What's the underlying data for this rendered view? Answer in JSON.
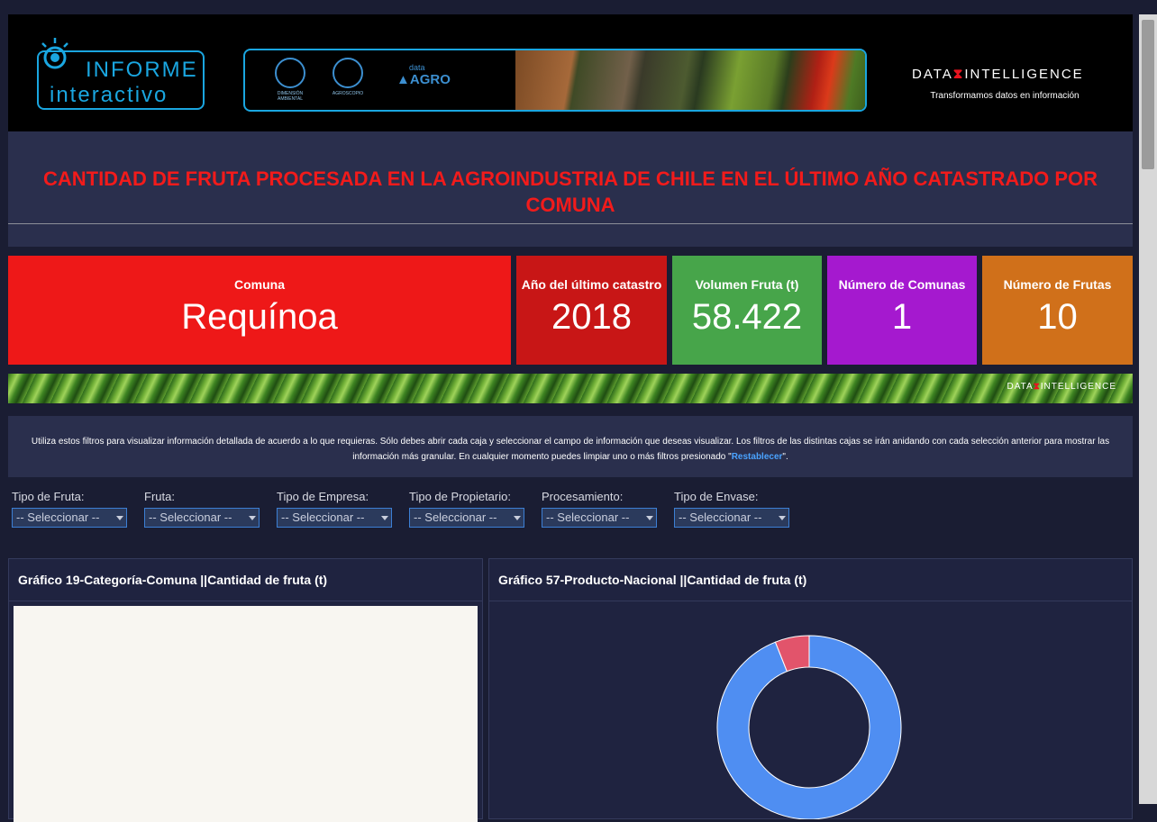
{
  "header": {
    "logo_line1": "INFORME",
    "logo_line2": "interactivo",
    "banner_logo1": "DIMENSIÓN AMBIENTAL",
    "banner_logo2": "AGROSCOPIO",
    "banner_logo3_small": "data",
    "banner_logo3": "AGRO",
    "brand_left": "DATA",
    "brand_right": "INTELLIGENCE",
    "brand_tagline": "Transformamos datos en información"
  },
  "title": "CANTIDAD DE FRUTA PROCESADA EN LA AGROINDUSTRIA DE CHILE EN EL ÚLTIMO AÑO CATASTRADO POR COMUNA",
  "kpis": [
    {
      "label": "Comuna",
      "value": "Requínoa",
      "color": "#ee1818"
    },
    {
      "label": "Año del último catastro",
      "value": "2018",
      "color": "#c81616"
    },
    {
      "label": "Volumen Fruta (t)",
      "value": "58.422",
      "color": "#47a54a"
    },
    {
      "label": "Número de Comunas",
      "value": "1",
      "color": "#a519cf"
    },
    {
      "label": "Número de Frutas",
      "value": "10",
      "color": "#d0701a"
    }
  ],
  "leaf_band": {
    "brand_left": "DATA",
    "brand_right": "INTELLIGENCE"
  },
  "info": {
    "text": "Utiliza estos filtros para visualizar información detallada de acuerdo a lo que requieras. Sólo debes abrir cada caja y seleccionar el campo de información que deseas visualizar. Los filtros de las distintas cajas se irán anidando con cada selección anterior para mostrar las información más granular. En cualquier momento puedes limpiar uno o más filtros presionado \"",
    "link": "Restablecer",
    "text_end": "\"."
  },
  "filters": [
    {
      "label": "Tipo de Fruta:",
      "value": "-- Seleccionar --"
    },
    {
      "label": "Fruta:",
      "value": "-- Seleccionar --"
    },
    {
      "label": "Tipo de Empresa:",
      "value": "-- Seleccionar --"
    },
    {
      "label": "Tipo de Propietario:",
      "value": "-- Seleccionar --"
    },
    {
      "label": "Procesamiento:",
      "value": "-- Seleccionar --"
    },
    {
      "label": "Tipo de Envase:",
      "value": "-- Seleccionar --"
    }
  ],
  "panels": [
    {
      "title": "Gráfico 19-Categoría-Comuna ||Cantidad de fruta (t)"
    },
    {
      "title": "Gráfico 57-Producto-Nacional ||Cantidad de fruta (t)"
    }
  ],
  "chart_data": {
    "type": "pie",
    "donut": true,
    "slices": [
      {
        "share": 0.94,
        "color": "#4f8ef2"
      },
      {
        "share": 0.06,
        "color": "#e2546b"
      }
    ]
  }
}
